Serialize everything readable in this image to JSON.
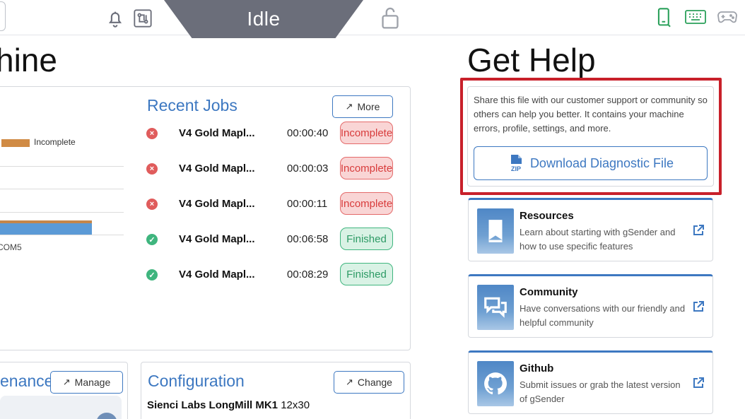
{
  "topbar": {
    "state_label": "Idle",
    "icons": [
      "bell-icon",
      "circuit-icon",
      "lock-icon",
      "phone-icon",
      "keyboard-icon",
      "gamepad-icon"
    ],
    "active_color": "#2aa05a",
    "inactive_color": "#6b6e7a"
  },
  "machine": {
    "heading": "hine",
    "stats": {
      "legend_label": "Incomplete",
      "axis_label": "COM5"
    },
    "recent_jobs": {
      "title": "Recent Jobs",
      "more_label": "More",
      "jobs": [
        {
          "name": "V4 Gold Mapl...",
          "time": "00:00:40",
          "status": "Incomplete"
        },
        {
          "name": "V4 Gold Mapl...",
          "time": "00:00:03",
          "status": "Incomplete"
        },
        {
          "name": "V4 Gold Mapl...",
          "time": "00:00:11",
          "status": "Incomplete"
        },
        {
          "name": "V4 Gold Mapl...",
          "time": "00:06:58",
          "status": "Finished"
        },
        {
          "name": "V4 Gold Mapl...",
          "time": "00:08:29",
          "status": "Finished"
        }
      ]
    },
    "maintenance": {
      "title": "enance",
      "manage_label": "Manage"
    },
    "configuration": {
      "title": "Configuration",
      "change_label": "Change",
      "machine_name": "Sienci Labs LongMill MK1",
      "machine_size": "12x30"
    }
  },
  "help": {
    "heading": "Get Help",
    "diagnostic": {
      "text": "Share this file with our customer support or community so others can help you better. It contains your machine errors, profile, settings, and more.",
      "button_label": "Download Diagnostic File",
      "icon_label": "ZIP"
    },
    "resources": [
      {
        "title": "Resources",
        "description": "Learn about starting with gSender and how to use specific features",
        "icon": "book-icon"
      },
      {
        "title": "Community",
        "description": "Have conversations with our friendly and helpful community",
        "icon": "chat-icon"
      },
      {
        "title": "Github",
        "description": "Submit issues or grab the latest version of gSender",
        "icon": "github-icon"
      }
    ]
  },
  "colors": {
    "accent": "#3d78c1",
    "highlight_frame": "#c8202a",
    "incomplete": "#d83c3c",
    "finished": "#2d9a65"
  }
}
